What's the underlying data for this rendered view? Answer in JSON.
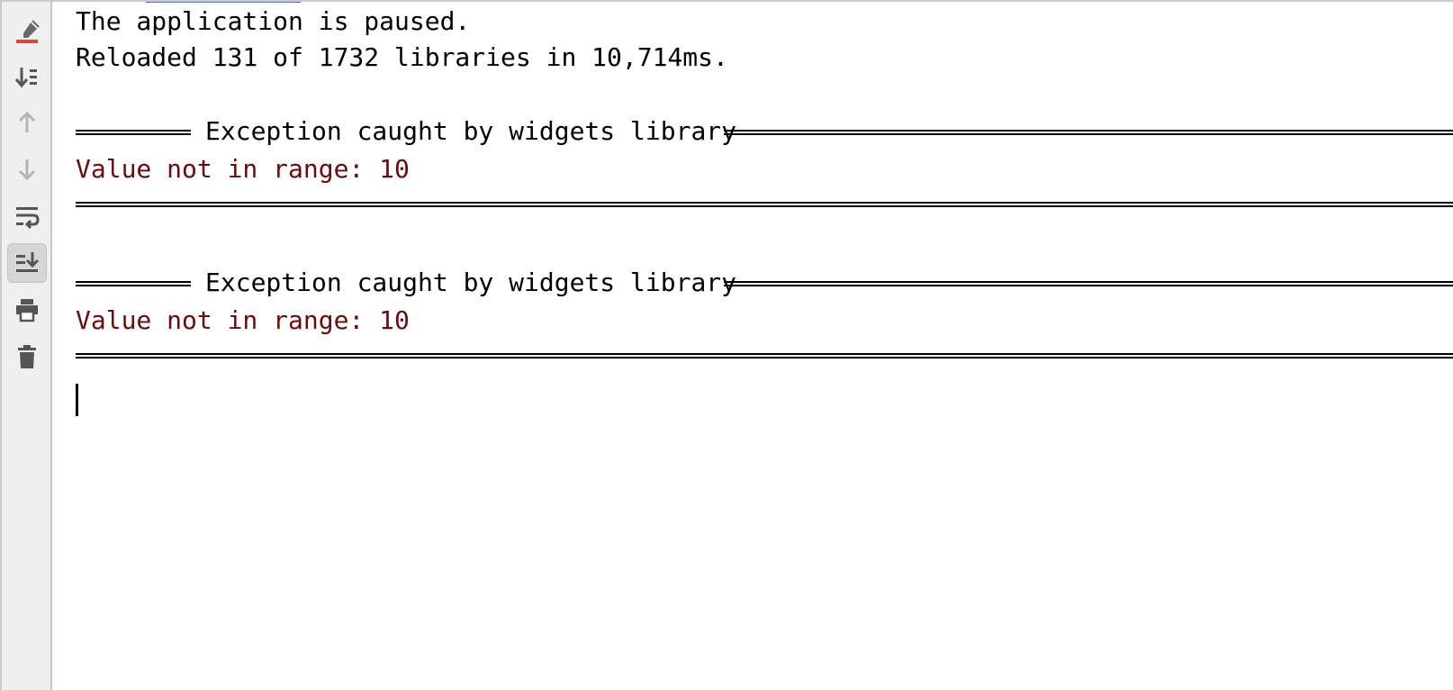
{
  "toolbar": {
    "buttons": [
      {
        "icon": "clear-all-icon"
      },
      {
        "icon": "scroll-to-end-icon"
      },
      {
        "icon": "up-arrow-icon"
      },
      {
        "icon": "down-arrow-icon"
      },
      {
        "icon": "soft-wrap-icon"
      },
      {
        "icon": "scroll-to-end-toggle-icon",
        "toggled": true
      },
      {
        "icon": "print-icon"
      },
      {
        "icon": "trash-icon"
      }
    ]
  },
  "console": {
    "status_line": "The application is paused.",
    "reload_line": "Reloaded 131 of 1732 libraries in 10,714ms.",
    "exceptions": [
      {
        "header": "Exception caught by widgets library",
        "message": "Value not in range: 10"
      },
      {
        "header": "Exception caught by widgets library",
        "message": "Value not in range: 10"
      }
    ]
  },
  "colors": {
    "error_text": "#6b0b0b",
    "toolbar_bg": "#efefef",
    "accent": "#3d7dc9",
    "clear_icon_red": "#d9483b"
  }
}
